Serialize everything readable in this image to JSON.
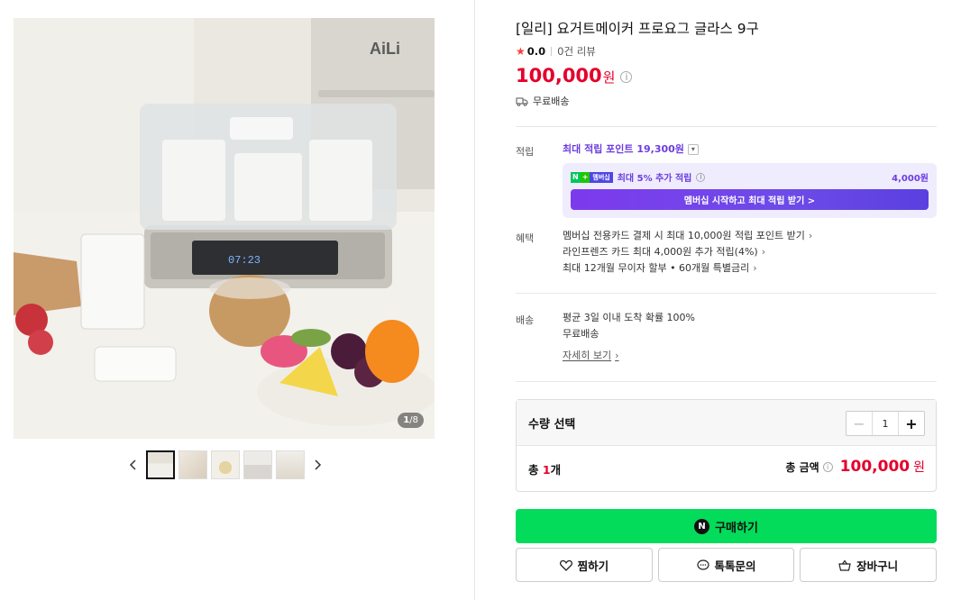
{
  "gallery": {
    "counter_current": "1",
    "counter_total": "/8",
    "brand_watermark": "AiLi",
    "display_time": "07:23"
  },
  "product": {
    "title": "[일리] 요거트메이커 프로요그 글라스 9구",
    "rating_score": "0.0",
    "review_count": "0건 리뷰",
    "price_value": "100,000",
    "price_unit": "원",
    "shipping": "무료배송"
  },
  "points": {
    "label": "적립",
    "max_points": "최대 적립 포인트 19,300원",
    "member_badge_n": "N",
    "member_badge_plus": "멤버십",
    "member_extra": "최대 5% 추가 적립",
    "member_amount": "4,000원",
    "member_cta": "멤버십 시작하고 최대 적립 받기 >"
  },
  "benefits": {
    "label": "혜택",
    "items": [
      "멤버십 전용카드 결제 시 최대 10,000원 적립 포인트 받기",
      "라인프렌즈 카드 최대 4,000원 추가 적립(4%)",
      "최대 12개월 무이자 할부 • 60개월 특별금리"
    ]
  },
  "delivery": {
    "label": "배송",
    "line1": "평균 3일 이내 도착 확률 100%",
    "line2": "무료배송",
    "more": "자세히 보기"
  },
  "quantity": {
    "label": "수량 선택",
    "value": "1",
    "total_prefix": "총 ",
    "total_count": "1",
    "total_suffix": "개",
    "total_label": "총 금액",
    "total_value": "100,000",
    "total_unit": "원"
  },
  "actions": {
    "buy": "구매하기",
    "buy_badge": "N",
    "wish": "찜하기",
    "talk": "톡톡문의",
    "cart": "장바구니"
  },
  "colors": {
    "price_red": "#e4002b",
    "naver_green": "#03db5a",
    "points_purple": "#6c3de0"
  }
}
